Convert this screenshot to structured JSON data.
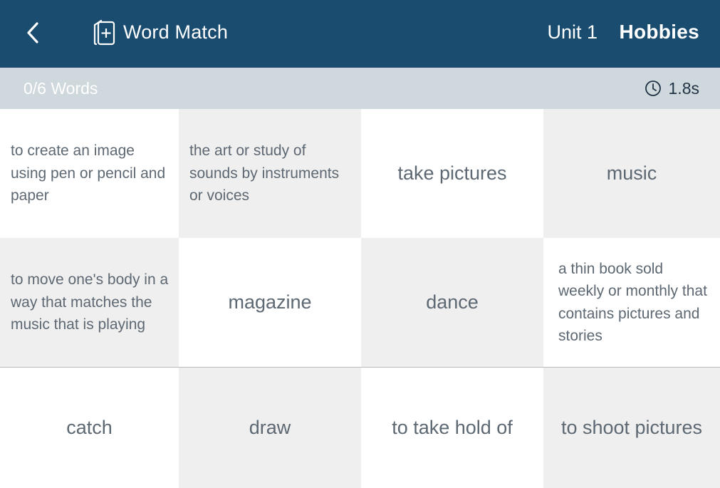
{
  "header": {
    "back_icon": "chevron-left-icon",
    "app_icon": "flashcard-add-icon",
    "title": "Word Match",
    "unit": "Unit 1",
    "topic": "Hobbies",
    "background": "#1a4c70"
  },
  "status": {
    "progress": "0/6 Words",
    "timer_icon": "clock-icon",
    "time": "1.8s",
    "background": "#cfd8dd"
  },
  "tiles": [
    {
      "text": "to create an image using pen or pencil and paper",
      "kind": "definition",
      "shade": "white"
    },
    {
      "text": "the art or study of sounds by instruments or voices",
      "kind": "definition",
      "shade": "grey"
    },
    {
      "text": "take pictures",
      "kind": "term",
      "shade": "white"
    },
    {
      "text": "music",
      "kind": "term",
      "shade": "grey"
    },
    {
      "text": "to move one's body in a way that matches the music that is playing",
      "kind": "definition",
      "shade": "grey"
    },
    {
      "text": "magazine",
      "kind": "term",
      "shade": "white"
    },
    {
      "text": "dance",
      "kind": "term",
      "shade": "grey"
    },
    {
      "text": "a thin book sold weekly or monthly that contains pictures and stories",
      "kind": "definition",
      "shade": "white"
    },
    {
      "text": "catch",
      "kind": "term",
      "shade": "white"
    },
    {
      "text": "draw",
      "kind": "term",
      "shade": "grey"
    },
    {
      "text": "to take hold of",
      "kind": "definition",
      "shade": "white"
    },
    {
      "text": "to shoot pictures",
      "kind": "definition",
      "shade": "grey"
    }
  ]
}
